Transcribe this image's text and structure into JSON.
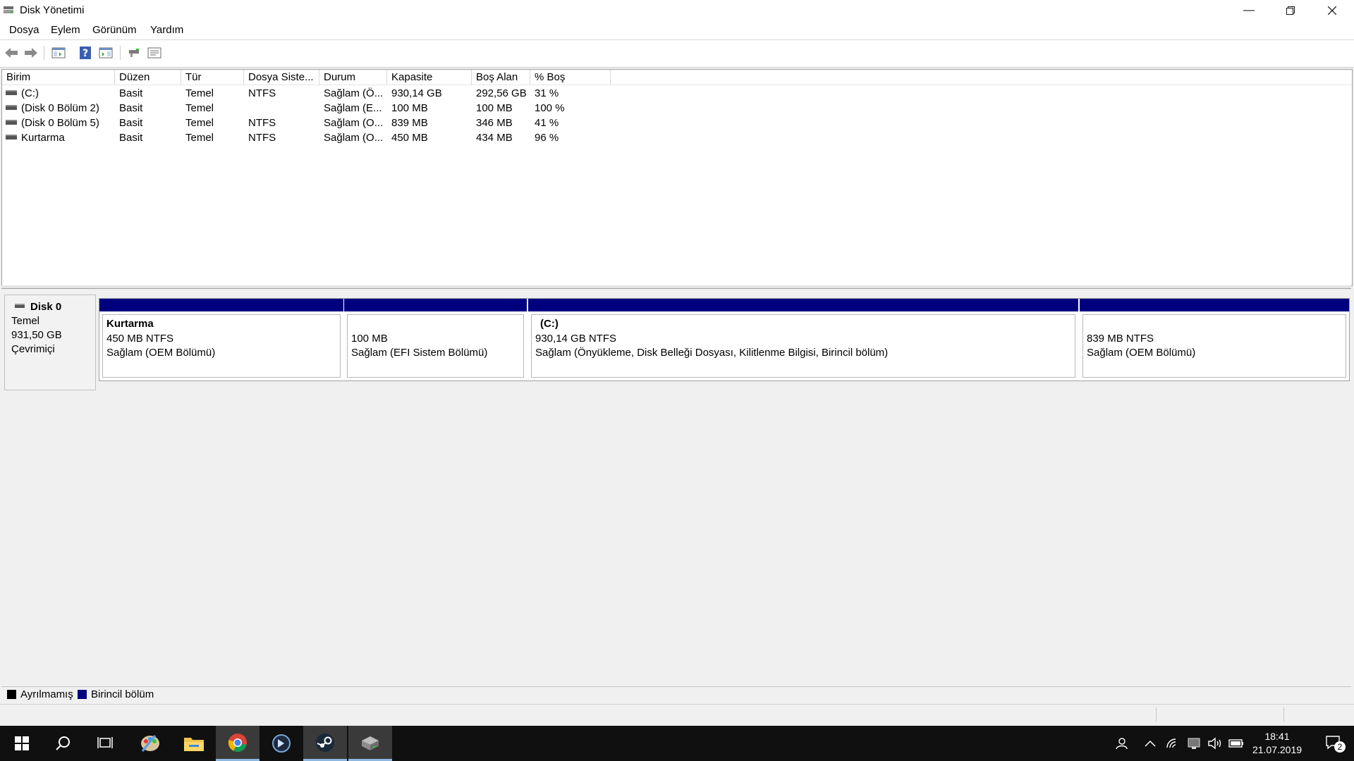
{
  "window": {
    "title": "Disk Yönetimi",
    "controls": [
      "minimize-icon",
      "restore-icon",
      "close-icon"
    ]
  },
  "menu": [
    "Dosya",
    "Eylem",
    "Görünüm",
    "Yardım"
  ],
  "toolbar": [
    "back-icon",
    "forward-icon",
    "console-tree-icon",
    "help-icon",
    "show-pane-icon",
    "connect-icon",
    "properties-icon"
  ],
  "volume_list": {
    "columns": [
      "Birim",
      "Düzen",
      "Tür",
      "Dosya Siste...",
      "Durum",
      "Kapasite",
      "Boş Alan",
      "% Boş"
    ],
    "rows": [
      [
        "(C:)",
        "Basit",
        "Temel",
        "NTFS",
        "Sağlam (Ö...",
        "930,14 GB",
        "292,56 GB",
        "31 %"
      ],
      [
        "(Disk 0 Bölüm 2)",
        "Basit",
        "Temel",
        "",
        "Sağlam (E...",
        "100 MB",
        "100 MB",
        "100 %"
      ],
      [
        "(Disk 0 Bölüm 5)",
        "Basit",
        "Temel",
        "NTFS",
        "Sağlam (O...",
        "839 MB",
        "346 MB",
        "41 %"
      ],
      [
        "Kurtarma",
        "Basit",
        "Temel",
        "NTFS",
        "Sağlam (O...",
        "450 MB",
        "434 MB",
        "96 %"
      ]
    ]
  },
  "disk": {
    "name": "Disk 0",
    "type": "Temel",
    "size": "931,50 GB",
    "state": "Çevrimiçi",
    "partitions": [
      {
        "title": "Kurtarma",
        "size": "450 MB NTFS",
        "status": "Sağlam (OEM Bölümü)"
      },
      {
        "title": "",
        "size": "100 MB",
        "status": "Sağlam (EFI Sistem Bölümü)"
      },
      {
        "title": "(C:)",
        "size": "930,14 GB NTFS",
        "status": "Sağlam (Önyükleme, Disk Belleği Dosyası, Kilitlenme Bilgisi, Birincil bölüm)"
      },
      {
        "title": "",
        "size": "839 MB NTFS",
        "status": "Sağlam (OEM Bölümü)"
      }
    ]
  },
  "legend": [
    {
      "label": "Ayrılmamış",
      "color": "#000000"
    },
    {
      "label": "Birincil bölüm",
      "color": "#00007f"
    }
  ],
  "taskbar": {
    "apps": [
      "windows-start-icon",
      "search-icon",
      "task-view-icon",
      "paint-app-icon",
      "file-explorer-icon",
      "chrome-icon",
      "app-icon",
      "steam-icon",
      "disk-management-icon"
    ],
    "tray": [
      "people-icon",
      "chevron-up-icon",
      "wifi-icon",
      "network-icon",
      "volume-icon",
      "battery-icon"
    ],
    "time": "18:41",
    "date": "21.07.2019",
    "notifications": "2"
  },
  "colors": {
    "primary_partition": "#00007f",
    "unallocated": "#000000"
  }
}
